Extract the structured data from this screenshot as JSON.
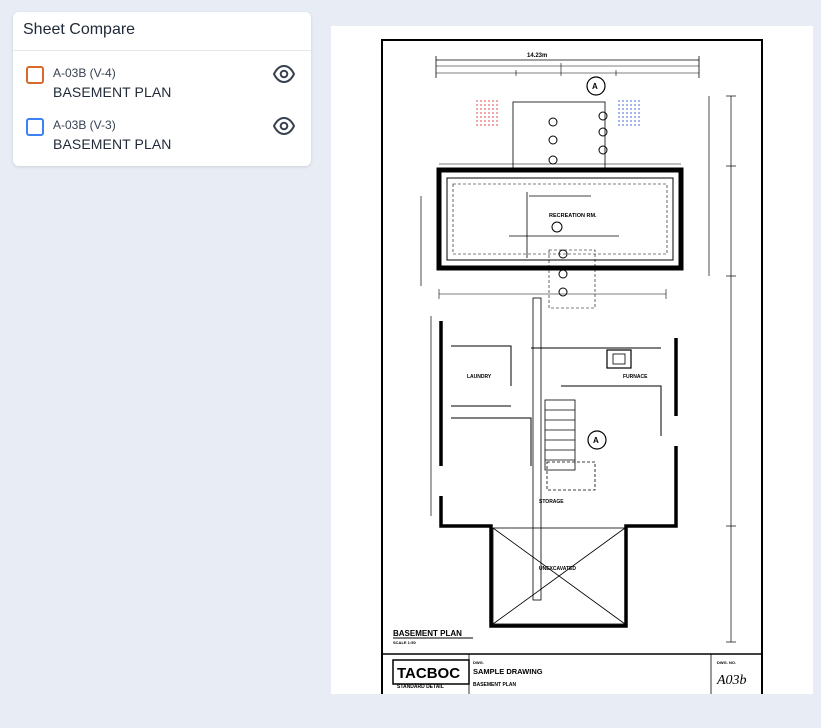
{
  "panel": {
    "title": "Sheet Compare",
    "sheets": [
      {
        "code": "A-03B (V-4)",
        "name": "BASEMENT PLAN",
        "checkbox_color": "#d9692b",
        "icon": "eye-icon"
      },
      {
        "code": "A-03B (V-3)",
        "name": "BASEMENT PLAN",
        "checkbox_color": "#3b82f6",
        "icon": "eye-icon"
      }
    ]
  },
  "drawing": {
    "top_dimension": "14.23m",
    "rooms": {
      "recreation": "RECREATION RM.",
      "laundry": "LAUNDRY",
      "furnace": "FURNACE",
      "storage": "STORAGE",
      "unexcavated": "UNEXCAVATED"
    },
    "plan_title": "BASEMENT PLAN",
    "plan_scale": "SCALE 1:50",
    "title_block": {
      "logo": "TACBOC",
      "logo_sub": "STANDARD DETAIL",
      "drawing_label": "DWG.",
      "drawing_name": "SAMPLE DRAWING",
      "sheet_title": "BASEMENT PLAN",
      "sheet_no_label": "DWG. NO.",
      "sheet_no": "A03b"
    }
  }
}
